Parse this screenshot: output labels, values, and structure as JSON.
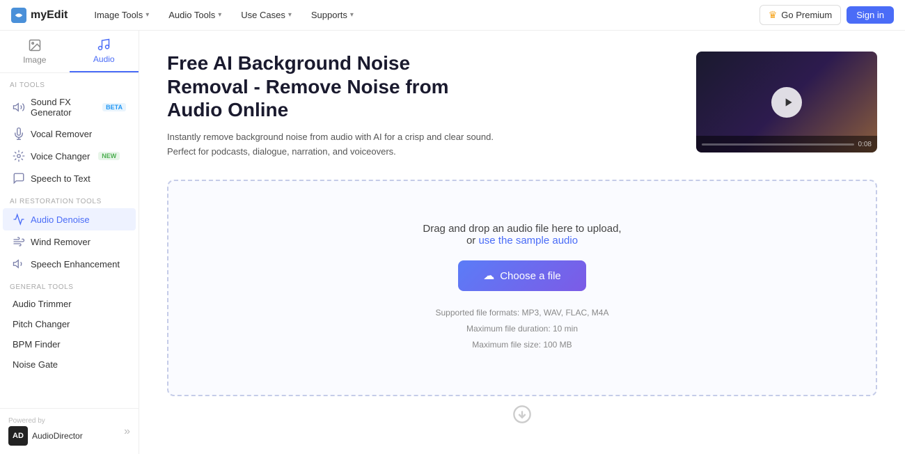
{
  "navbar": {
    "logo_text": "myEdit",
    "nav_items": [
      {
        "label": "Image Tools",
        "has_arrow": true
      },
      {
        "label": "Audio Tools",
        "has_arrow": true
      },
      {
        "label": "Use Cases",
        "has_arrow": true
      },
      {
        "label": "Supports",
        "has_arrow": true
      }
    ],
    "btn_premium": "Go Premium",
    "btn_signin": "Sign in"
  },
  "sidebar": {
    "tab_image": "Image",
    "tab_audio": "Audio",
    "section_ai_tools": "AI TOOLS",
    "ai_tools": [
      {
        "label": "Sound FX Generator",
        "badge": "BETA",
        "badge_type": "beta"
      },
      {
        "label": "Vocal Remover",
        "badge": null
      },
      {
        "label": "Voice Changer",
        "badge": "NEW",
        "badge_type": "new"
      },
      {
        "label": "Speech to Text",
        "badge": null
      }
    ],
    "section_restoration": "AI RESTORATION TOOLS",
    "restoration_tools": [
      {
        "label": "Audio Denoise",
        "active": true
      },
      {
        "label": "Wind Remover"
      },
      {
        "label": "Speech Enhancement"
      }
    ],
    "section_general": "GENERAL TOOLS",
    "general_tools": [
      {
        "label": "Audio Trimmer"
      },
      {
        "label": "Pitch Changer"
      },
      {
        "label": "BPM Finder"
      },
      {
        "label": "Noise Gate"
      }
    ],
    "powered_by": "Powered by",
    "partner_name": "AudioDirector",
    "partner_abbr": "AD"
  },
  "hero": {
    "title_line1": "Free AI Background Noise",
    "title_line2": "Removal - Remove Noise from",
    "title_line3": "Audio Online",
    "description": "Instantly remove background noise from audio with AI for a crisp and clear sound. Perfect for podcasts, dialogue, narration, and voiceovers.",
    "video_time": "0:08"
  },
  "dropzone": {
    "drag_text": "Drag and drop an audio file here to upload,",
    "or_text": "or",
    "sample_link": "use the sample audio",
    "choose_btn": "Choose a file",
    "formats_label": "Supported file formats: MP3, WAV, FLAC, M4A",
    "duration_label": "Maximum file duration: 10 min",
    "size_label": "Maximum file size: 100 MB"
  }
}
